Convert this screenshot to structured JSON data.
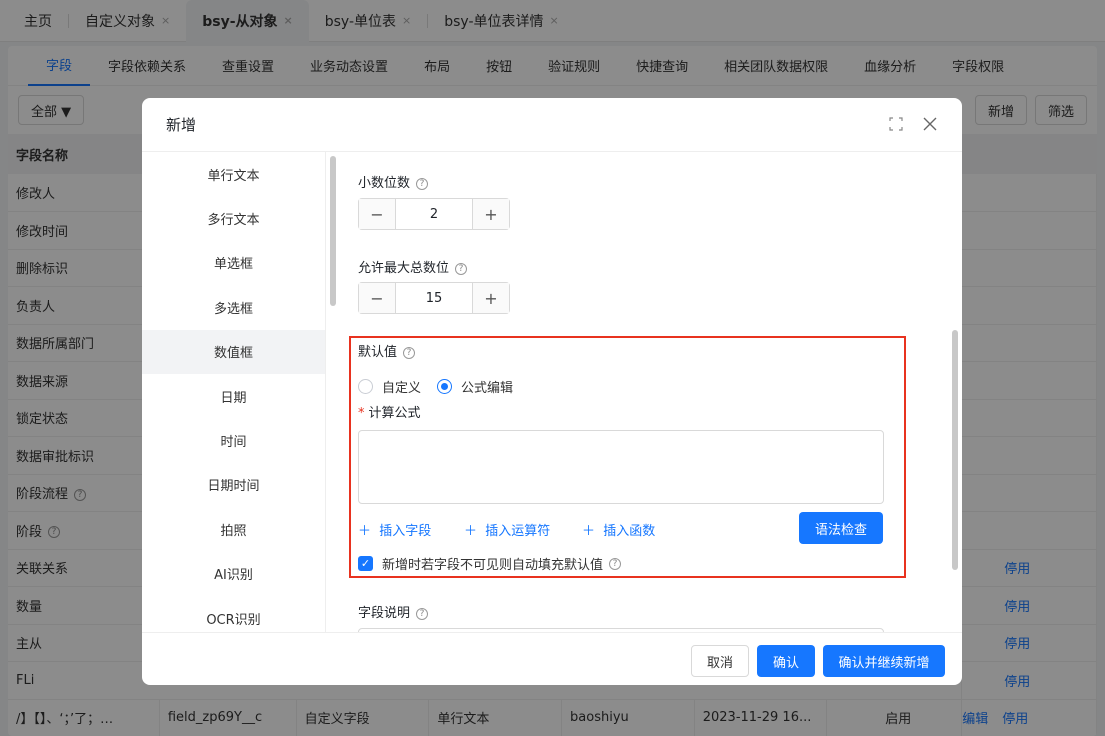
{
  "tabs": [
    {
      "label": "主页",
      "closable": false
    },
    {
      "label": "自定义对象",
      "closable": true
    },
    {
      "label": "bsy-从对象",
      "closable": true,
      "active": true
    },
    {
      "label": "bsy-单位表",
      "closable": true
    },
    {
      "label": "bsy-单位表详情",
      "closable": true
    }
  ],
  "close_glyph": "×",
  "subtabs": [
    "字段",
    "字段依赖关系",
    "查重设置",
    "业务动态设置",
    "布局",
    "按钮",
    "验证规则",
    "快捷查询",
    "相关团队数据权限",
    "血缘分析",
    "字段权限"
  ],
  "toolbar": {
    "filter_label": "全部 ▼",
    "add_label": "新增",
    "filter_btn_label": "筛选"
  },
  "table": {
    "header": "字段名称",
    "rows": [
      {
        "name": "修改人"
      },
      {
        "name": "修改时间"
      },
      {
        "name": "删除标识"
      },
      {
        "name": "负责人"
      },
      {
        "name": "数据所属部门"
      },
      {
        "name": "数据来源"
      },
      {
        "name": "锁定状态"
      },
      {
        "name": "数据审批标识"
      },
      {
        "name": "阶段流程",
        "help": true
      },
      {
        "name": "阶段",
        "help": true
      },
      {
        "name": "关联关系",
        "action": "停用"
      },
      {
        "name": "数量",
        "action": "停用"
      },
      {
        "name": "主从",
        "action": "停用"
      },
      {
        "name": "FLi",
        "action": "停用"
      }
    ],
    "last_row": {
      "name": "/】【】、‘；’了；…",
      "api": "field_zp69Y__c",
      "kind": "自定义字段",
      "type": "单行文本",
      "owner": "baoshiyu",
      "time": "2023-11-29 16...",
      "status": "启用",
      "edit": "编辑",
      "disable": "停用"
    }
  },
  "modal": {
    "title": "新增",
    "field_types": [
      "单行文本",
      "多行文本",
      "单选框",
      "多选框",
      "数值框",
      "日期",
      "时间",
      "日期时间",
      "拍照",
      "AI识别",
      "OCR识别"
    ],
    "active_type": "数值框",
    "decimal_label": "小数位数",
    "decimal_value": "2",
    "max_digits_label": "允许最大总数位",
    "max_digits_value": "15",
    "default_label": "默认值",
    "radio_custom": "自定义",
    "radio_formula": "公式编辑",
    "formula_label": "计算公式",
    "insert_field": "插入字段",
    "insert_operator": "插入运算符",
    "insert_function": "插入函数",
    "syntax_check": "语法检查",
    "autofill_label": "新增时若字段不可见则自动填充默认值",
    "field_desc_label": "字段说明",
    "cancel": "取消",
    "confirm": "确认",
    "confirm_continue": "确认并继续新增"
  },
  "colors": {
    "accent": "#1677ff",
    "highlight_box": "#e8321f"
  }
}
